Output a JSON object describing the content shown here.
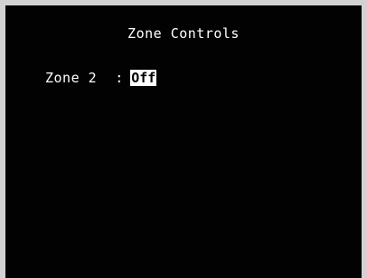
{
  "screen": {
    "title": "Zone Controls",
    "setting": {
      "label": "Zone 2",
      "separator": ":",
      "value": "Off"
    }
  },
  "colors": {
    "background": "#020202",
    "frame": "#d2d2d2",
    "text": "#ffffff",
    "highlight_bg": "#ffffff",
    "highlight_text": "#000000"
  }
}
